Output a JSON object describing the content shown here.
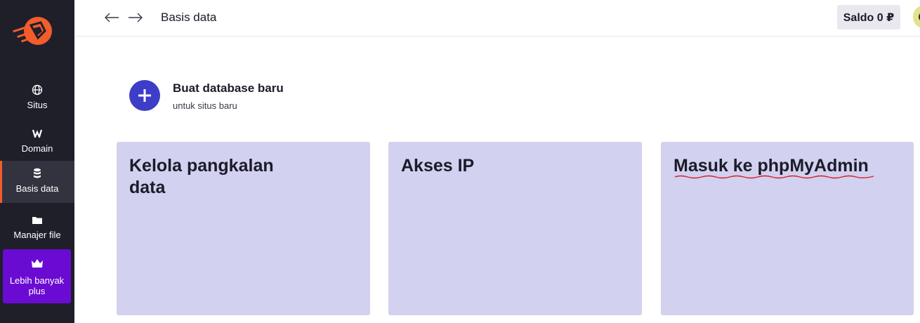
{
  "header": {
    "title": "Basis data",
    "balance": "Saldo 0 ₽"
  },
  "sidebar": {
    "items": [
      {
        "label": "Situs",
        "icon": "globe-icon"
      },
      {
        "label": "Domain",
        "icon": "domain-w-icon"
      },
      {
        "label": "Basis data",
        "icon": "database-icon",
        "active": true
      },
      {
        "label": "Manajer file",
        "icon": "folder-icon"
      },
      {
        "label": "Lebih banyak plus",
        "icon": "crown-icon"
      }
    ]
  },
  "create": {
    "title": "Buat database baru",
    "subtitle": "untuk situs baru"
  },
  "cards": [
    {
      "title": "Kelola pangkalan data"
    },
    {
      "title": "Akses IP"
    },
    {
      "title": "Masuk ke phpMyAdmin"
    }
  ],
  "colors": {
    "sidebar_bg": "#1f1f2a",
    "accent": "#f25d2b",
    "primary": "#3d3dc8",
    "promo": "#6a0bd3",
    "card_bg": "#d2d1ef"
  }
}
